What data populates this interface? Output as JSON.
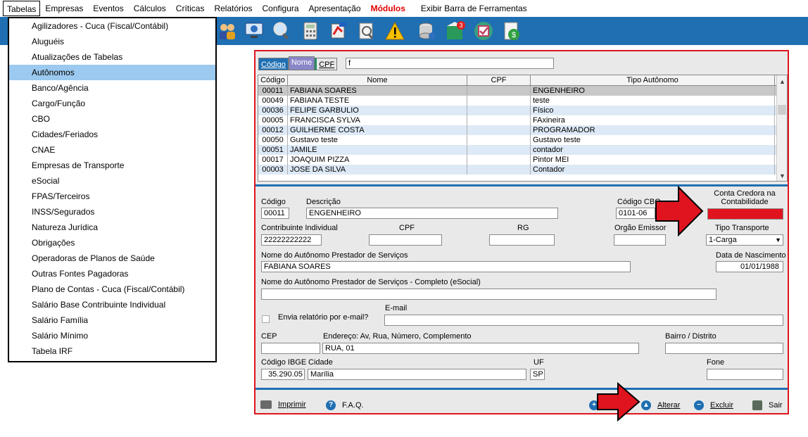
{
  "menubar": {
    "items": [
      "Tabelas",
      "Empresas",
      "Eventos",
      "Cálculos",
      "Críticas",
      "Relatórios",
      "Configura",
      "Apresentação",
      "Módulos",
      "Exibir Barra de Ferramentas"
    ]
  },
  "dropdown": {
    "items": [
      "Agilizadores - Cuca (Fiscal/Contábil)",
      "Aluguéis",
      "Atualizações de Tabelas",
      "Autônomos",
      "Banco/Agência",
      "Cargo/Função",
      "CBO",
      "Cidades/Feriados",
      "CNAE",
      "Empresas de Transporte",
      "eSocial",
      "FPAS/Terceiros",
      "INSS/Segurados",
      "Natureza Jurídica",
      "Obrigações",
      "Operadoras de Planos de Saúde",
      "Outras Fontes Pagadoras",
      "Plano de Contas - Cuca (Fiscal/Contábil)",
      "Salário Base Contribuinte Individual",
      "Salário Família",
      "Salário Mínimo",
      "Tabela IRF"
    ],
    "selected": "Autônomos"
  },
  "search": {
    "tab_codigo": "Código",
    "tab_nome": "Nome",
    "tab_cpf": "CPF",
    "value": "f"
  },
  "grid": {
    "headers": [
      "Código",
      "Nome",
      "CPF",
      "Tipo Autônomo"
    ],
    "rows": [
      [
        "00011",
        "FABIANA SOARES",
        "",
        "ENGENHEIRO"
      ],
      [
        "00049",
        "FABIANA TESTE",
        "",
        "teste"
      ],
      [
        "00036",
        "FELIPE GARBULIO",
        "",
        "Físico"
      ],
      [
        "00005",
        "FRANCISCA SYLVA",
        "",
        "FAxineira"
      ],
      [
        "00012",
        "GUILHERME COSTA",
        "",
        "PROGRAMADOR"
      ],
      [
        "00050",
        "Gustavo teste",
        "",
        "Gustavo teste"
      ],
      [
        "00051",
        "JAMILE",
        "",
        "contador"
      ],
      [
        "00017",
        "JOAQUIM PIZZA",
        "",
        "Pintor MEI"
      ],
      [
        "00003",
        "JOSE DA SILVA",
        "",
        "Contador"
      ]
    ]
  },
  "form": {
    "codigo_label": "Código",
    "codigo_value": "00011",
    "descricao_label": "Descrição",
    "descricao_value": "ENGENHEIRO",
    "cbo_label": "Código CBO",
    "cbo_value": "0101-06",
    "conta_label_1": "Conta Credora na",
    "conta_label_2": "Contabilidade",
    "conta_value": "",
    "contrib_label": "Contribuinte Individual",
    "contrib_value": "22222222222",
    "cpf_label": "CPF",
    "cpf_value": "",
    "rg_label": "RG",
    "rg_value": "",
    "orgao_label": "Orgão Emissor",
    "orgao_value": "",
    "tipo_transporte_label": "Tipo Transporte",
    "tipo_transporte_value": "1-Carga",
    "nome_prest_label": "Nome do Autônomo Prestador de Serviços",
    "nome_prest_value": "FABIANA SOARES",
    "data_nasc_label": "Data de Nascimento",
    "data_nasc_value": "01/01/1988",
    "nome_completo_label": "Nome do Autônomo Prestador de Serviços - Completo (eSocial)",
    "nome_completo_value": "",
    "envia_label": "Envia relatório por e-mail?",
    "email_label": "E-mail",
    "email_value": "",
    "cep_label": "CEP",
    "cep_value": "",
    "endereco_label": "Endereço: Av, Rua, Número, Complemento",
    "endereco_value": "RUA, 01",
    "bairro_label": "Bairro / Distrito",
    "bairro_value": "",
    "ibge_label": "Código IBGE",
    "ibge_value": "35.290.05",
    "cidade_label": "Cidade",
    "cidade_value": "Marília",
    "uf_label": "UF",
    "uf_value": "SP",
    "fone_label": "Fone",
    "fone_value": ""
  },
  "footer": {
    "imprimir": "Imprimir",
    "faq": "F.A.Q.",
    "alterar": "Alterar",
    "excluir": "Excluir",
    "sair": "Sair"
  },
  "colors": {
    "accent": "#1f6fb2",
    "highlight_red": "#e0141e",
    "selection": "#9cc9ef"
  }
}
